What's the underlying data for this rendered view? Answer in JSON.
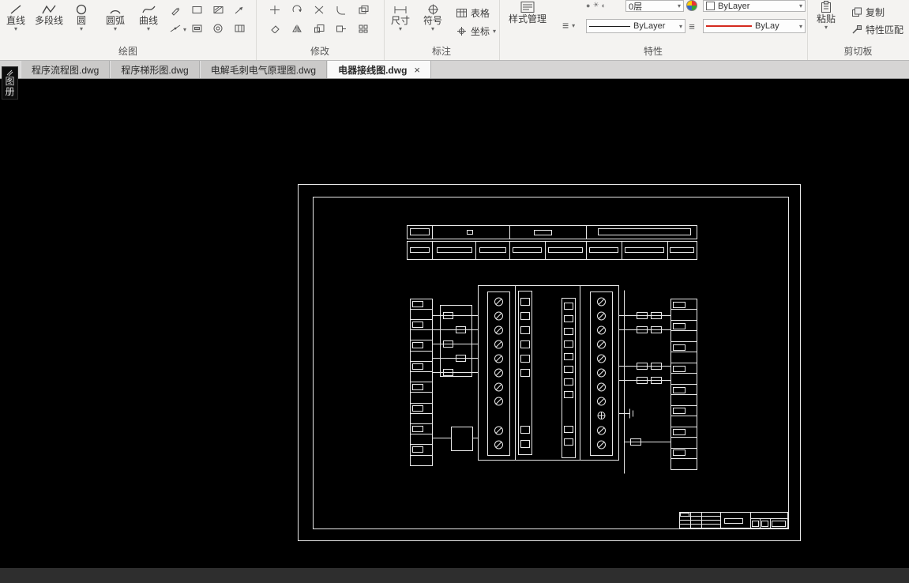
{
  "icons": {
    "dropdown": "▾",
    "close": "×",
    "menu": "≡",
    "sun": "☀",
    "half": "◐",
    "dot": "●"
  },
  "ribbon": {
    "draw": {
      "label": "绘图",
      "line": "直线",
      "polyline": "多段线",
      "circle": "圆",
      "arc": "圆弧",
      "spline": "曲线"
    },
    "modify": {
      "label": "修改"
    },
    "annotate": {
      "label": "标注",
      "dimension": "尺寸",
      "symbol": "符号",
      "table": "表格",
      "coordinate": "坐标"
    },
    "properties": {
      "label": "特性",
      "style_manager": "样式管理",
      "layer_value": "0层",
      "color_value": "ByLayer",
      "linetype_value": "ByLayer",
      "lineweight_value": "ByLay"
    },
    "clipboard": {
      "label": "剪切板",
      "paste": "粘贴",
      "copy": "复制",
      "match": "特性匹配"
    }
  },
  "tabs": {
    "items": [
      {
        "label": "程序流程图.dwg"
      },
      {
        "label": "程序梯形图.dwg"
      },
      {
        "label": "电解毛刺电气原理图.dwg"
      },
      {
        "label": "电器接线图.dwg"
      }
    ]
  },
  "side_tab": {
    "char_top": "图",
    "char_bottom": "册"
  }
}
